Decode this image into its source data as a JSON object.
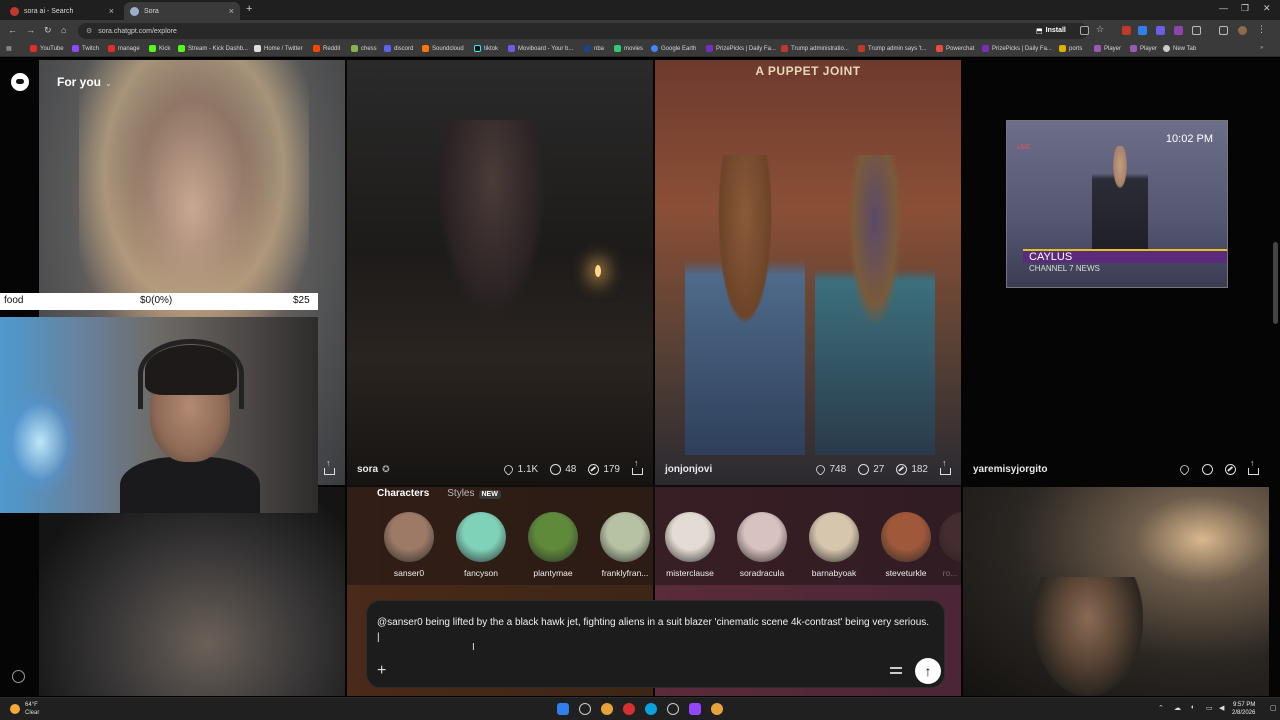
{
  "browser": {
    "tabs": [
      {
        "title": "sora ai - Search",
        "active": false
      },
      {
        "title": "Sora",
        "active": true
      }
    ],
    "url": "sora.chatgpt.com/explore",
    "install_label": "Install",
    "bookmarks": [
      "YouTube",
      "Twitch",
      "manage",
      "Kick",
      "Stream - Kick Dashb...",
      "Home / Twitter",
      "Reddit",
      "chess",
      "discord",
      "Soundcloud",
      "tiktok",
      "Moviboard - Your b...",
      "nba",
      "movies",
      "Google Earth",
      "PrizePicks | Daily Fa...",
      "Trump administratio...",
      "Trump admin says 't...",
      "Powerchat",
      "PrizePicks | Daily Fa...",
      "ports",
      "Player",
      "Player",
      "New Tab"
    ]
  },
  "sora": {
    "feed_label": "For you",
    "tiles": [
      {
        "user": "",
        "likes": "",
        "comments": "",
        "remixes": ""
      },
      {
        "user": "sora",
        "likes": "1.1K",
        "comments": "48",
        "remixes": "179"
      },
      {
        "user": "jonjonjovi",
        "likes": "748",
        "comments": "27",
        "remixes": "182",
        "overlay_text": "A PUPPET JOINT"
      },
      {
        "user": "yaremisyjorgito",
        "likes": "",
        "comments": "",
        "remixes": ""
      }
    ],
    "tv": {
      "time": "10:02 PM",
      "name": "CAYLUS",
      "channel": "CHANNEL 7 NEWS",
      "live": "LIVE"
    },
    "characters_panel": {
      "tab_characters": "Characters",
      "tab_styles": "Styles",
      "new_badge": "NEW",
      "characters": [
        {
          "name": "sanser0",
          "color": "#9c7a66"
        },
        {
          "name": "fancyson",
          "color": "#7fd2b8"
        },
        {
          "name": "plantymae",
          "color": "#5f8a3a"
        },
        {
          "name": "franklyfran...",
          "color": "#b7c2a4"
        },
        {
          "name": "misterclause",
          "color": "#e4dcd4"
        },
        {
          "name": "soradracula",
          "color": "#d8c2bf"
        },
        {
          "name": "barnabyoak",
          "color": "#d7c6ae"
        },
        {
          "name": "steveturkle",
          "color": "#a0583a"
        },
        {
          "name": "ro...",
          "color": "#6a4a4a"
        }
      ]
    },
    "prompt": {
      "text": "@sanser0 being lifted by the a black hawk jet, fighting aliens in a suit blazer 'cinematic scene 4k-contrast' being very serious. |"
    }
  },
  "overlay": {
    "goal_label": "food",
    "goal_progress": "$0(0%)",
    "goal_target": "$25"
  },
  "taskbar": {
    "weather_temp": "64°F",
    "weather_desc": "Clear",
    "time": "9:57 PM",
    "date": "2/8/2026"
  }
}
